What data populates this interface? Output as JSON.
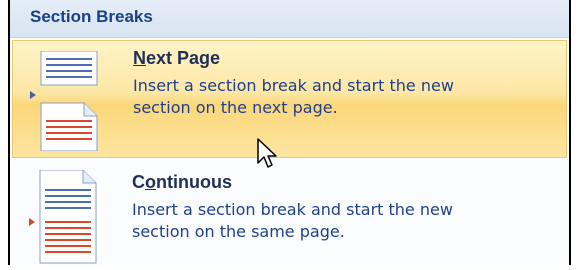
{
  "menu": {
    "header": "Section Breaks",
    "items": [
      {
        "title_accel": "N",
        "title_rest": "ext Page",
        "description_line1": "Insert a section break and start the new",
        "description_line2": "section on the next page.",
        "icon": "next-page-break-icon",
        "highlighted": true
      },
      {
        "title_pre": "C",
        "title_accel": "o",
        "title_rest": "ntinuous",
        "description_line1": "Insert a section break and start the new",
        "description_line2": "section on the same page.",
        "icon": "continuous-break-icon",
        "highlighted": false
      }
    ]
  },
  "colors": {
    "header_text": "#15428b",
    "highlight": "#fbd77a",
    "description_text": "#1f3f8f",
    "icon_red": "#d9482a",
    "icon_blue": "#4b6fb5"
  }
}
